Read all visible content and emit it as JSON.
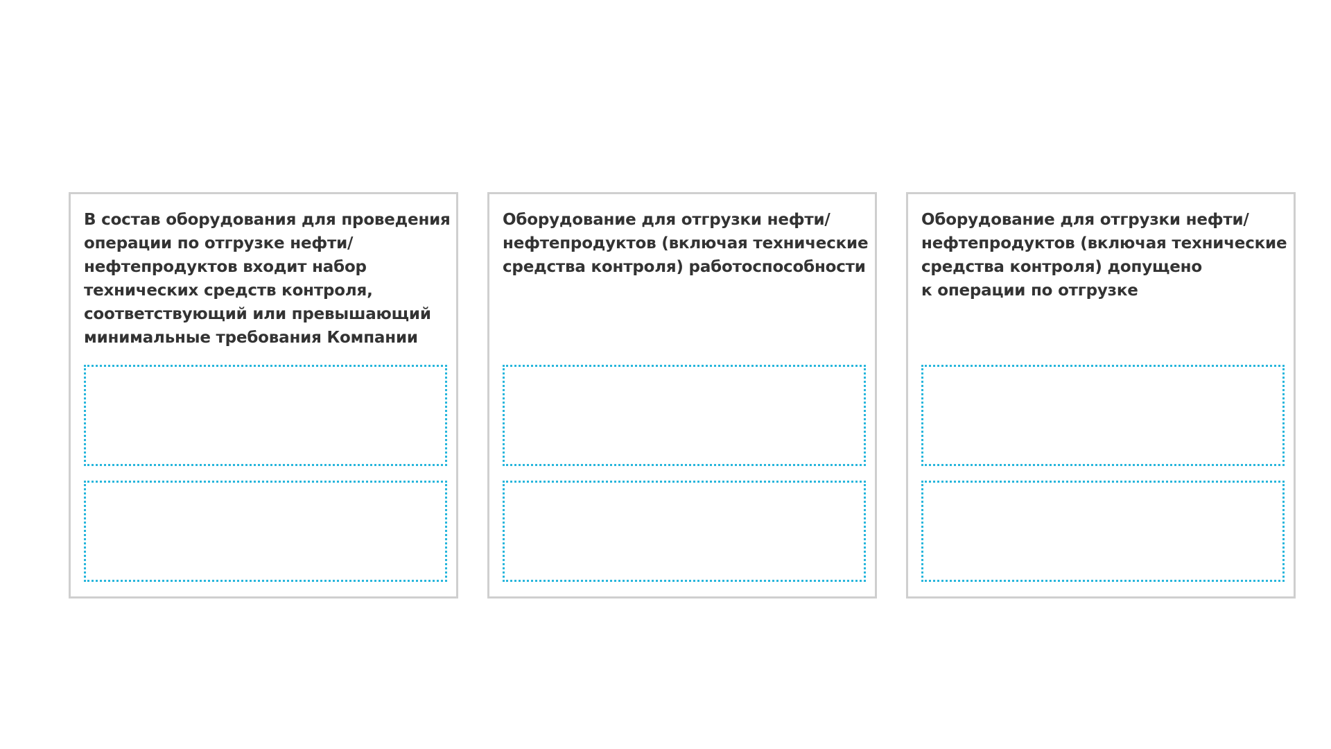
{
  "cards": [
    {
      "text": "В состав оборудования для проведения\nоперации по отгрузке нефти/\nнефтепродуктов входит набор\nтехнических средств контроля,\nсоответствующий или превышающий\nминимальные требования Компании"
    },
    {
      "text": "Оборудование для отгрузки нефти/\nнефтепродуктов (включая технические\nсредства контроля) работоспособности"
    },
    {
      "text": "Оборудование для отгрузки нефти/\nнефтепродуктов (включая технические\nсредства контроля) допущено\nк операции по отгрузке"
    }
  ],
  "colors": {
    "card_border": "#cfcfcf",
    "dropzone_border": "#27b6dc",
    "text": "#333333"
  }
}
